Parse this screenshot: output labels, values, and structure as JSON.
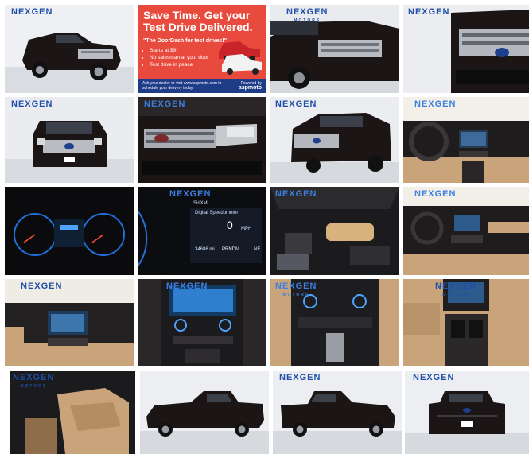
{
  "gallery": {
    "logo_text": "NEXGEN",
    "logo_sub": "MOTORS",
    "ad": {
      "headline": "Save Time. Get your Test Drive Delivered.",
      "quote": "\"The DoorDash for test drives!\"",
      "bullets": [
        "Starts at $9*",
        "No salesman at your door",
        "Test drive in peace"
      ],
      "footer": "Ask your dealer or visit www.aspmoto.com to schedule your delivery today",
      "powered_by": "Powered by",
      "brand": "aspmoto"
    },
    "cluster": {
      "app": "SiriXM",
      "title": "Digital Speedometer",
      "speed": "0",
      "unit": "MPH",
      "odometer": "34686 mi",
      "gear": "PRNDM",
      "heading": "NE"
    }
  },
  "colors": {
    "truck": "#1b1516",
    "studio": "#e9ebee",
    "interior_tan": "#c9a47a",
    "ad_red": "#e84b3d",
    "logo_blue": "#1f4fa8"
  }
}
